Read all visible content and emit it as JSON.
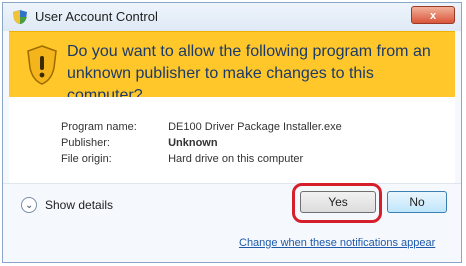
{
  "window": {
    "title": "User Account Control",
    "close_label": "x"
  },
  "banner": {
    "question": "Do you want to allow the following program from an unknown publisher to make changes to this computer?"
  },
  "details": {
    "program_name_label": "Program name:",
    "program_name_value": "DE100 Driver Package Installer.exe",
    "publisher_label": "Publisher:",
    "publisher_value": "Unknown",
    "file_origin_label": "File origin:",
    "file_origin_value": "Hard drive on this computer"
  },
  "footer": {
    "show_details_label": "Show details",
    "yes_label": "Yes",
    "no_label": "No",
    "notifications_link": "Change when these notifications appear"
  },
  "icons": {
    "title_icon": "uac-shield-icon",
    "banner_icon": "warning-shield-icon",
    "expand_icon": "chevron-down-icon"
  },
  "colors": {
    "banner": "#ffc72a",
    "highlight": "#d61f2c",
    "link": "#1e5aa9"
  }
}
